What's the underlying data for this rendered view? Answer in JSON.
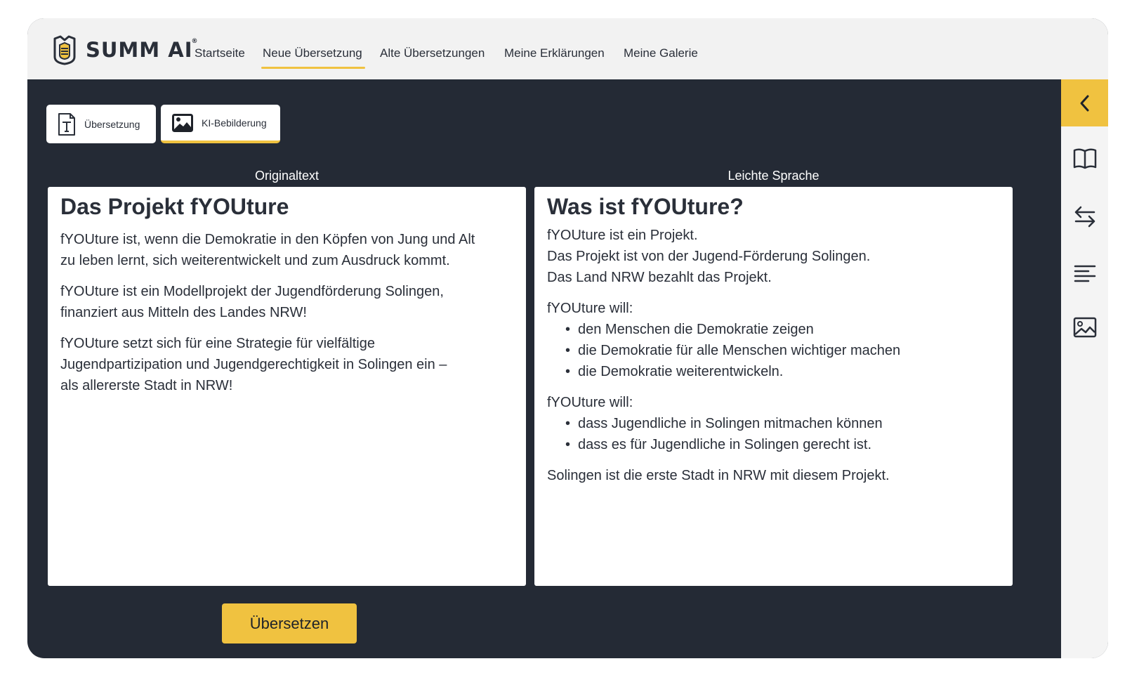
{
  "brand": {
    "name": "SUMM AI",
    "reg": "®"
  },
  "nav": {
    "items": [
      {
        "label": "Startseite"
      },
      {
        "label": "Neue Übersetzung",
        "active": true
      },
      {
        "label": "Alte Übersetzungen"
      },
      {
        "label": "Meine Erklärungen"
      },
      {
        "label": "Meine Galerie"
      }
    ]
  },
  "modes": [
    {
      "label": "Übersetzung",
      "icon": "text-document-icon"
    },
    {
      "label": "KI-Bebilderung",
      "icon": "image-icon",
      "active": true
    }
  ],
  "original": {
    "label": "Originaltext",
    "title": "Das Projekt fYOUture",
    "paragraphs": [
      [
        "fYOUture ist, wenn die Demokratie in den Köpfen von Jung und Alt",
        "zu leben lernt, sich weiterentwickelt und zum Ausdruck kommt."
      ],
      [
        "fYOUture ist ein Modellprojekt der Jugendförderung Solingen,",
        "finanziert aus Mitteln des Landes NRW!"
      ],
      [
        "fYOUture setzt sich für eine Strategie für vielfältige",
        "Jugendpartizipation und Jugendgerechtigkeit in Solingen ein –",
        "als allererste Stadt in NRW!"
      ]
    ]
  },
  "simple": {
    "label": "Leichte Sprache",
    "title": "Was ist fYOUture?",
    "intro": [
      "fYOUture ist ein Projekt.",
      "Das Projekt ist von der Jugend-Förderung Solingen.",
      "Das Land NRW bezahlt das Projekt."
    ],
    "list1_heading": "fYOUture will:",
    "list1": [
      "den Menschen die Demokratie zeigen",
      "die Demokratie für alle Menschen wichtiger machen",
      "die Demokratie weiterentwickeln."
    ],
    "list2_heading": "fYOUture will:",
    "list2": [
      "dass Jugendliche in Solingen mitmachen können",
      "dass es für Jugendliche in Solingen gerecht ist."
    ],
    "closing": "Solingen ist die erste Stadt in NRW mit diesem Projekt."
  },
  "actions": {
    "translate_label": "Übersetzen"
  },
  "sidebar": {
    "icons": [
      "chevron-left-icon",
      "book-icon",
      "swap-arrows-icon",
      "align-left-icon",
      "image-icon"
    ]
  },
  "colors": {
    "accent": "#f0c240",
    "dark_bg": "#242a35",
    "nav_bg": "#f2f2f2",
    "text": "#2a2f39"
  }
}
